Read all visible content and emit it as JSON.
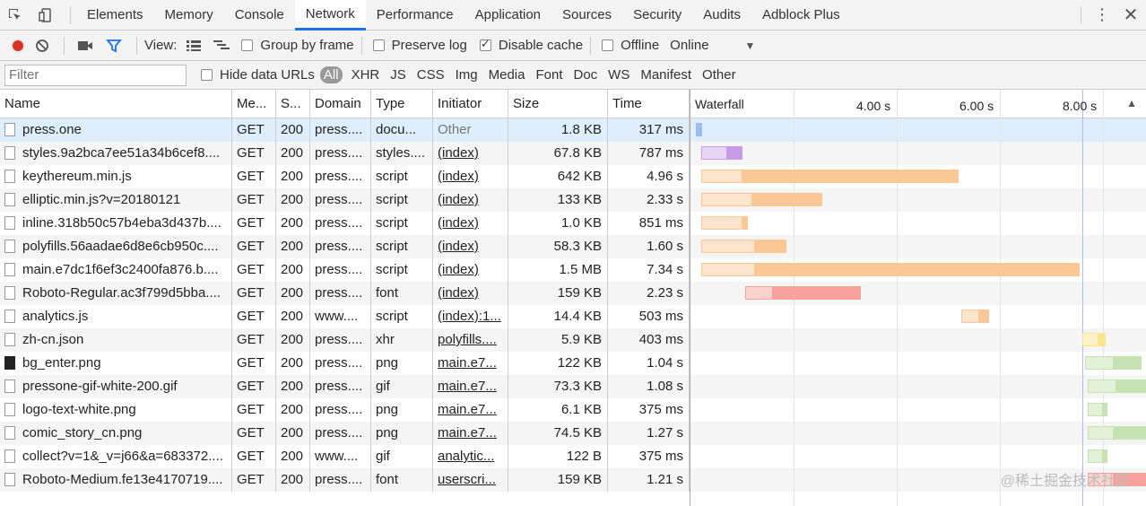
{
  "tabs": [
    "Elements",
    "Memory",
    "Console",
    "Network",
    "Performance",
    "Application",
    "Sources",
    "Security",
    "Audits",
    "Adblock Plus"
  ],
  "active_tab": "Network",
  "toolbar": {
    "view_label": "View:",
    "group_by_frame": "Group by frame",
    "preserve_log": "Preserve log",
    "disable_cache": "Disable cache",
    "offline": "Offline",
    "throttle": "Online"
  },
  "filter": {
    "placeholder": "Filter",
    "hide_data_urls": "Hide data URLs",
    "types": [
      "All",
      "XHR",
      "JS",
      "CSS",
      "Img",
      "Media",
      "Font",
      "Doc",
      "WS",
      "Manifest",
      "Other"
    ]
  },
  "columns": [
    "Name",
    "Me...",
    "S...",
    "Domain",
    "Type",
    "Initiator",
    "Size",
    "Time",
    "Waterfall"
  ],
  "waterfall_ticks": [
    "4.00 s",
    "6.00 s",
    "8.00 s"
  ],
  "rows": [
    {
      "name": "press.one",
      "method": "GET",
      "status": "200",
      "domain": "press....",
      "type": "docu...",
      "initiator": "Other",
      "size": "1.8 KB",
      "time": "317 ms",
      "start_s": 0.0,
      "wait_s": 0.13,
      "dl_s": 0.0,
      "color": "#9bbcf0",
      "wcolor": "#9bbcf0"
    },
    {
      "name": "styles.9a2bca7ee51a34b6cef8....",
      "method": "GET",
      "status": "200",
      "domain": "press....",
      "type": "styles....",
      "initiator": "(index)",
      "size": "67.8 KB",
      "time": "787 ms",
      "start_s": 0.1,
      "wait_s": 0.5,
      "dl_s": 0.3,
      "color": "#c89be6",
      "wcolor": "#e8d4f6"
    },
    {
      "name": "keythereum.min.js",
      "method": "GET",
      "status": "200",
      "domain": "press....",
      "type": "script",
      "initiator": "(index)",
      "size": "642 KB",
      "time": "4.96 s",
      "start_s": 0.1,
      "wait_s": 0.8,
      "dl_s": 4.2,
      "color": "#fbc794",
      "wcolor": "#fde4cc"
    },
    {
      "name": "elliptic.min.js?v=20180121",
      "method": "GET",
      "status": "200",
      "domain": "press....",
      "type": "script",
      "initiator": "(index)",
      "size": "133 KB",
      "time": "2.33 s",
      "start_s": 0.1,
      "wait_s": 1.0,
      "dl_s": 1.35,
      "color": "#fbc794",
      "wcolor": "#fde4cc"
    },
    {
      "name": "inline.318b50c57b4eba3d437b....",
      "method": "GET",
      "status": "200",
      "domain": "press....",
      "type": "script",
      "initiator": "(index)",
      "size": "1.0 KB",
      "time": "851 ms",
      "start_s": 0.1,
      "wait_s": 0.8,
      "dl_s": 0.1,
      "color": "#fbc794",
      "wcolor": "#fde4cc"
    },
    {
      "name": "polyfills.56aadae6d8e6cb950c....",
      "method": "GET",
      "status": "200",
      "domain": "press....",
      "type": "script",
      "initiator": "(index)",
      "size": "58.3 KB",
      "time": "1.60 s",
      "start_s": 0.1,
      "wait_s": 1.05,
      "dl_s": 0.6,
      "color": "#fbc794",
      "wcolor": "#fde4cc"
    },
    {
      "name": "main.e7dc1f6ef3c2400fa876.b....",
      "method": "GET",
      "status": "200",
      "domain": "press....",
      "type": "script",
      "initiator": "(index)",
      "size": "1.5 MB",
      "time": "7.34 s",
      "start_s": 0.1,
      "wait_s": 1.05,
      "dl_s": 6.3,
      "color": "#fbc794",
      "wcolor": "#fde4cc"
    },
    {
      "name": "Roboto-Regular.ac3f799d5bba....",
      "method": "GET",
      "status": "200",
      "domain": "press....",
      "type": "font",
      "initiator": "(index)",
      "size": "159 KB",
      "time": "2.23 s",
      "start_s": 0.95,
      "wait_s": 0.55,
      "dl_s": 1.7,
      "color": "#f7a29a",
      "wcolor": "#fbd2cd"
    },
    {
      "name": "analytics.js",
      "method": "GET",
      "status": "200",
      "domain": "www....",
      "type": "script",
      "initiator": "(index):1...",
      "size": "14.4 KB",
      "time": "503 ms",
      "start_s": 5.15,
      "wait_s": 0.35,
      "dl_s": 0.18,
      "color": "#fbc794",
      "wcolor": "#fde4cc"
    },
    {
      "name": "zh-cn.json",
      "method": "GET",
      "status": "200",
      "domain": "press....",
      "type": "xhr",
      "initiator": "polyfills....",
      "size": "5.9 KB",
      "time": "403 ms",
      "start_s": 7.5,
      "wait_s": 0.3,
      "dl_s": 0.15,
      "color": "#fbe58c",
      "wcolor": "#fdf3c6"
    },
    {
      "name": "bg_enter.png",
      "method": "GET",
      "status": "200",
      "domain": "press....",
      "type": "png",
      "initiator": "main.e7...",
      "size": "122 KB",
      "time": "1.04 s",
      "start_s": 7.55,
      "wait_s": 0.55,
      "dl_s": 0.55,
      "color": "#c5e3b0",
      "wcolor": "#e2f1d8"
    },
    {
      "name": "pressone-gif-white-200.gif",
      "method": "GET",
      "status": "200",
      "domain": "press....",
      "type": "gif",
      "initiator": "main.e7...",
      "size": "73.3 KB",
      "time": "1.08 s",
      "start_s": 7.6,
      "wait_s": 0.55,
      "dl_s": 0.6,
      "color": "#c5e3b0",
      "wcolor": "#e2f1d8"
    },
    {
      "name": "logo-text-white.png",
      "method": "GET",
      "status": "200",
      "domain": "press....",
      "type": "png",
      "initiator": "main.e7...",
      "size": "6.1 KB",
      "time": "375 ms",
      "start_s": 7.6,
      "wait_s": 0.3,
      "dl_s": 0.08,
      "color": "#c5e3b0",
      "wcolor": "#e2f1d8"
    },
    {
      "name": "comic_story_cn.png",
      "method": "GET",
      "status": "200",
      "domain": "press....",
      "type": "png",
      "initiator": "main.e7...",
      "size": "74.5 KB",
      "time": "1.27 s",
      "start_s": 7.6,
      "wait_s": 0.5,
      "dl_s": 0.8,
      "color": "#c5e3b0",
      "wcolor": "#e2f1d8"
    },
    {
      "name": "collect?v=1&_v=j66&a=683372....",
      "method": "GET",
      "status": "200",
      "domain": "www....",
      "type": "gif",
      "initiator": "analytic...",
      "size": "122 B",
      "time": "375 ms",
      "start_s": 7.6,
      "wait_s": 0.3,
      "dl_s": 0.08,
      "color": "#c5e3b0",
      "wcolor": "#e2f1d8"
    },
    {
      "name": "Roboto-Medium.fe13e4170719....",
      "method": "GET",
      "status": "200",
      "domain": "press....",
      "type": "font",
      "initiator": "userscri...",
      "size": "159 KB",
      "time": "1.21 s",
      "start_s": 7.6,
      "wait_s": 0.5,
      "dl_s": 0.8,
      "color": "#f7a29a",
      "wcolor": "#fbd2cd"
    }
  ],
  "watermark": "@稀土掘金技术社区"
}
